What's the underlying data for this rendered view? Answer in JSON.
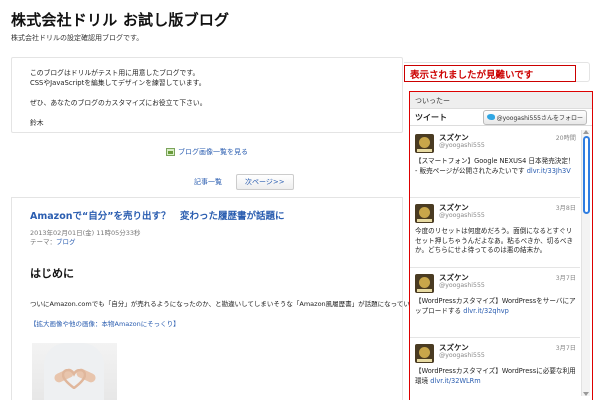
{
  "site": {
    "title": "株式会社ドリル お試し版ブログ",
    "description": "株式会社ドリルの設定確認用ブログです。"
  },
  "intro": {
    "lines": [
      "このブログはドリルがテスト用に用意したブログです。",
      "CSSやJavaScriptを編集してデザインを練習しています。",
      "ぜひ、あなたのブログのカスタマイズにお役立て下さい。",
      "鈴木"
    ]
  },
  "gallery": {
    "link_label": "ブログ画像一覧を見る"
  },
  "pager": {
    "archive_label": "記事一覧",
    "next_label": "次ページ>>"
  },
  "post": {
    "title": "Amazonで“自分”を売り出す？　変わった履歴書が話題に",
    "date": "2013年02月01日(金) 11時05分33秒",
    "category_prefix": "テーマ：",
    "category": "ブログ",
    "heading": "はじめに",
    "body": "ついにAmazon.comでも「自分」が売れるようになったのか、と勘違いしてしまいそうな「Amazon風履歴書」が話題になっています。",
    "image_link": "【拡大画像や他の画像：本物Amazonにそっくり】"
  },
  "note": {
    "text": "表示されましたが見難いです"
  },
  "twitter": {
    "widget_title": "ついったー",
    "tweet_label": "ツイート",
    "follow_label": "@yoogashi555さんをフォロー",
    "tweets": [
      {
        "name": "スズケン",
        "handle": "@yoogashi555",
        "time": "20時間",
        "text": "【スマートフォン】Google NEXUS4 日本発売決定！ - 販売ページが公開されたみたいです ",
        "link": "dlvr.it/33Jh3V"
      },
      {
        "name": "スズケン",
        "handle": "@yoogashi555",
        "time": "3月8日",
        "text": "今度のリセットは何度めだろう。面倒になるとすぐリセット押しちゃうんだよなあ。粘るべきか、切るべきか。どちらにせよ待ってるのは悪の結末か。",
        "link": ""
      },
      {
        "name": "スズケン",
        "handle": "@yoogashi555",
        "time": "3月7日",
        "text": "【WordPressカスタマイズ】WordPressをサーバにアップロードする ",
        "link": "dlvr.it/32qhvp"
      },
      {
        "name": "スズケン",
        "handle": "@yoogashi555",
        "time": "3月7日",
        "text": "【WordPressカスタマイズ】WordPressに必要な利用環境 ",
        "link": "dlvr.it/32WLRm"
      }
    ]
  }
}
